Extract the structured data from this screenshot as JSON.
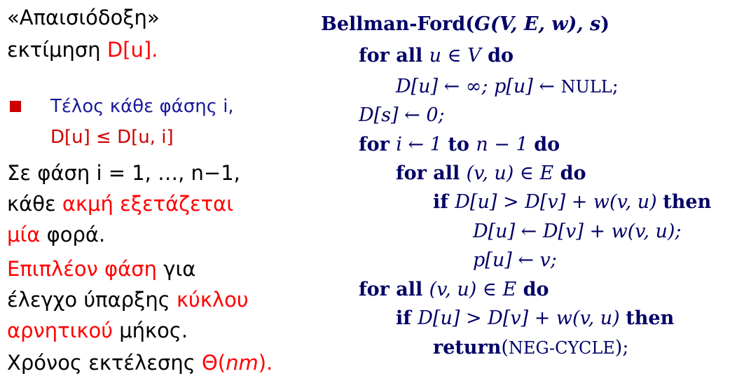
{
  "left": {
    "p1_line1": "«Απαισιόδοξη»",
    "p1_line2_pre": "εκτίμηση ",
    "p1_line2_red": "D[u].",
    "bullet_line1": "Τέλος κάθε φάσης i,",
    "bullet_line2": "D[u] ≤ D[u, i]",
    "p2_line1": "Σε φάση i = 1, …, n−1,",
    "p2_line2_pre": "κάθε ",
    "p2_line2_red": "ακμή εξετάζεται",
    "p2_line3_red": "μία",
    "p2_line3_post": " φορά.",
    "p3_line1_red": "Επιπλέον φάση",
    "p3_line1_post": " για",
    "p3_line2_pre": "έλεγχο ύπαρξης ",
    "p3_line2_red": "κύκλου",
    "p3_line3_red": "αρνητικού",
    "p3_line3_post": " μήκος.",
    "p4_pre": "Χρόνος εκτέλεσης ",
    "p4_red_theta": "Θ(",
    "p4_red_nm": "nm",
    "p4_red_close": ")."
  },
  "algorithm": {
    "header_name": "Bellman-Ford(",
    "header_args": "G(V, E, w), s",
    "header_close": ")",
    "l1_kw1": "for all ",
    "l1_math": "u ∈ V",
    "l1_kw2": " do",
    "l2_math": "D[u] ← ∞; p[u] ← ",
    "l2_sc": "NULL",
    "l2_end": ";",
    "l3_math": "D[s] ← 0;",
    "l4_kw1": "for ",
    "l4_math1": "i ← 1 ",
    "l4_kw2": "to ",
    "l4_math2": "n − 1 ",
    "l4_kw3": "do",
    "l5_kw1": "for all ",
    "l5_math": "(v, u) ∈ E",
    "l5_kw2": " do",
    "l6_kw1": "if ",
    "l6_math": "D[u] > D[v] + w(v, u) ",
    "l6_kw2": "then",
    "l7_math": "D[u] ← D[v] + w(v, u);",
    "l8_math": "p[u] ← v;",
    "l9_kw1": "for all ",
    "l9_math": "(v, u) ∈ E",
    "l9_kw2": " do",
    "l10_kw1": "if ",
    "l10_math": "D[u] > D[v] + w(v, u) ",
    "l10_kw2": "then",
    "l11_kw": "return",
    "l11_open": "(",
    "l11_sc": "NEG-CYCLE",
    "l11_close": ");"
  },
  "colors": {
    "text": "#000000",
    "highlight": "#ff0000",
    "bullet": "#cc0000",
    "sub_text": "#1a1a99",
    "code": "#000066"
  }
}
